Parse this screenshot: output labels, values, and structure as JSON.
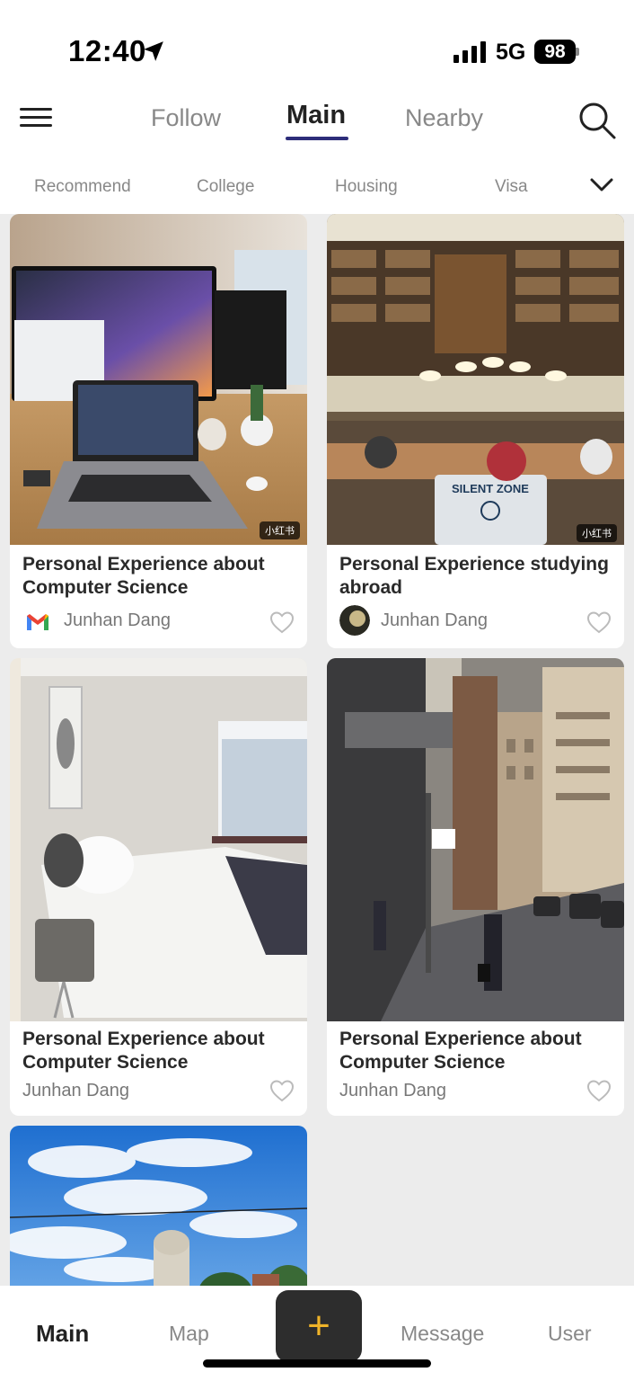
{
  "status": {
    "time": "12:40",
    "network": "5G",
    "battery": "98"
  },
  "header": {
    "tabs": [
      {
        "label": "Follow"
      },
      {
        "label": "Main"
      },
      {
        "label": "Nearby"
      }
    ]
  },
  "categories": [
    "Recommend",
    "College",
    "Housing",
    "Visa"
  ],
  "posts": [
    {
      "title": "Personal Experience about Computer Science",
      "author": "Junhan Dang",
      "author_icon": "gmail-icon",
      "image": "desk-setup-photo",
      "watermark": "小红书"
    },
    {
      "title": "Personal Experience studying abroad",
      "author": "Junhan Dang",
      "author_icon": "user-avatar",
      "image": "library-photo",
      "watermark": "小红书"
    },
    {
      "title": "Personal Experience about Computer Science",
      "author": "Junhan Dang",
      "image": "bedroom-photo"
    },
    {
      "title": "Personal Experience about Computer Science",
      "author": "Junhan Dang",
      "image": "city-street-photo"
    },
    {
      "image": "sky-building-photo"
    }
  ],
  "bottom_nav": {
    "items": [
      {
        "label": "Main"
      },
      {
        "label": "Map"
      },
      {
        "label": "Message"
      },
      {
        "label": "User"
      }
    ],
    "add_label": "+"
  },
  "colors": {
    "accent": "#2d2d7a",
    "add_button_bg": "#2d2d2d",
    "add_plus": "#f0b429"
  }
}
